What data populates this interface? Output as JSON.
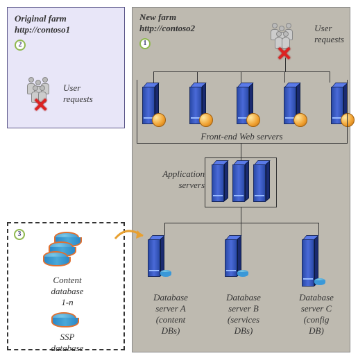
{
  "original": {
    "title": "Original farm",
    "url": "http://contoso1",
    "badge": "2",
    "user_label": "User\nrequests"
  },
  "new": {
    "title": "New farm",
    "url": "http://contoso2",
    "badge": "1",
    "user_label": "User\nrequests",
    "web_label": "Front-end Web servers",
    "app_label": "Application\nservers",
    "db_a": "Database\nserver A\n(content\nDBs)",
    "db_b": "Database\nserver B\n(services\nDBs)",
    "db_c": "Database\nserver C\n(config\nDB)"
  },
  "db_box": {
    "badge": "3",
    "content_label": "Content\ndatabase\n1-n",
    "ssp_label": "SSP\ndatabase"
  }
}
